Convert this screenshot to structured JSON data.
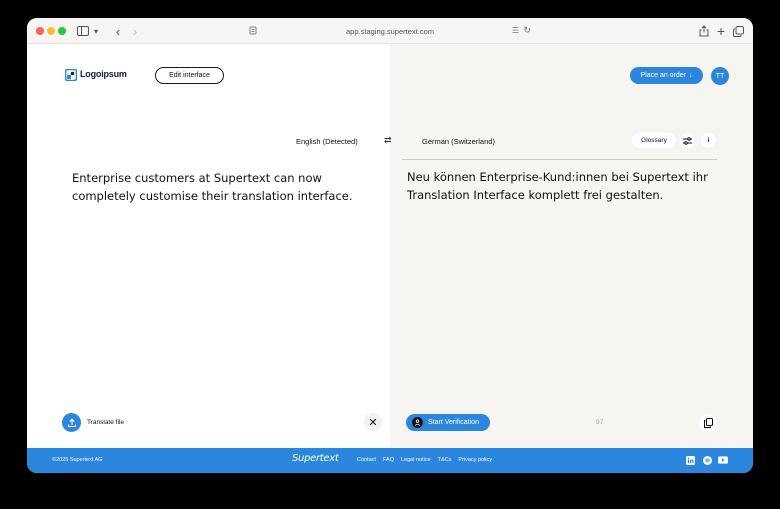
{
  "browser": {
    "url": "app.staging.supertext.com"
  },
  "header": {
    "logo_text": "Logoipsum",
    "edit_label": "Edit interface",
    "order_label": "Place an order",
    "avatar_initials": "TT"
  },
  "languages": {
    "source": "English (Detected)",
    "target": "German (Switzerland)",
    "glossary_label": "Glossary"
  },
  "editor": {
    "source_text": "Enterprise customers at Supertext can now completely customise their translation interface.",
    "target_text": "Neu können Enterprise-Kund:innen bei Supertext ihr Translation Interface komplett frei gestalten.",
    "translate_file_label": "Translate file",
    "verify_label": "Start Verification",
    "char_count": "97"
  },
  "footer": {
    "copyright": "©2025 Supertext AG",
    "brand": "Supertext",
    "links": [
      "Contact",
      "FAQ",
      "Legal notice",
      "T&Cs",
      "Privacy policy"
    ]
  },
  "colors": {
    "accent": "#2b86de",
    "right_pane_bg": "#f7f5f2"
  },
  "icons": [
    "search-icon",
    "swap-icon",
    "settings-icon",
    "info-icon",
    "upload-icon",
    "close-icon",
    "verify-icon",
    "copy-icon",
    "linkedin-icon",
    "spotify-icon",
    "youtube-icon"
  ]
}
